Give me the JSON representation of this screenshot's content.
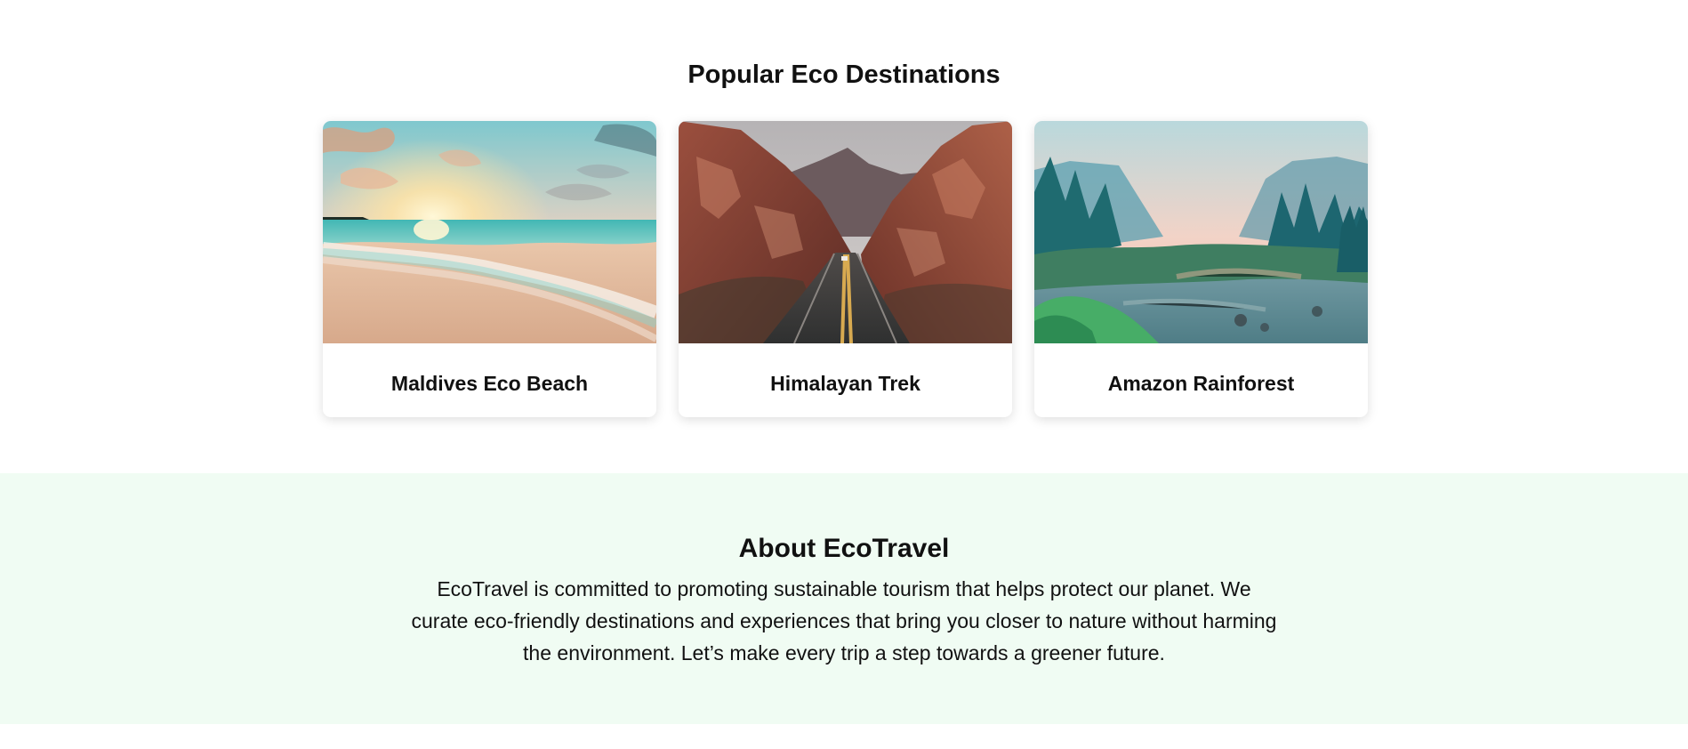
{
  "destinations": {
    "title": "Popular Eco Destinations",
    "cards": [
      {
        "title": "Maldives Eco Beach",
        "image": "beach-sunset-image"
      },
      {
        "title": "Himalayan Trek",
        "image": "mountain-road-image"
      },
      {
        "title": "Amazon Rainforest",
        "image": "forest-river-image"
      }
    ]
  },
  "about": {
    "title": "About EcoTravel",
    "text": "EcoTravel is committed to promoting sustainable tourism that helps protect our planet. We curate eco-friendly destinations and experiences that bring you closer to nature without harming the environment. Let’s make every trip a step towards a greener future."
  },
  "colors": {
    "about_background": "#f0fcf3",
    "text": "#111111",
    "card_background": "#ffffff"
  }
}
